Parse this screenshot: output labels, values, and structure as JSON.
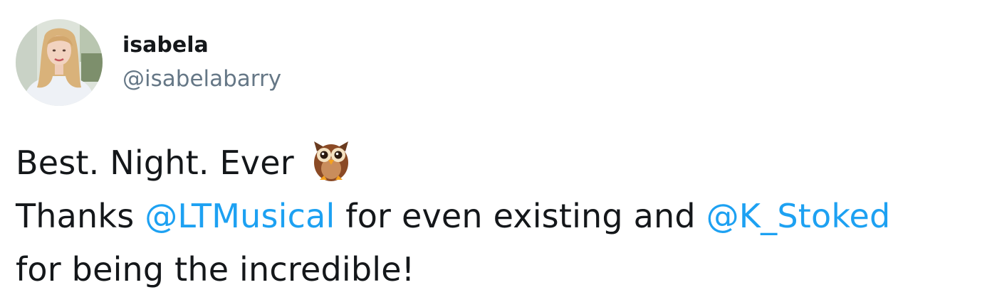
{
  "user": {
    "display_name": "isabela",
    "handle": "@isabelabarry"
  },
  "tweet": {
    "line1": {
      "text": "Best. Night. Ever",
      "emoji_icon": "owl-emoji-icon"
    },
    "line2": {
      "part1": "Thanks ",
      "mention1": "@LTMusical",
      "part2": " for even existing and ",
      "mention2": "@K_Stoked"
    },
    "line3": {
      "text": "for being the incredible!"
    }
  },
  "colors": {
    "text": "#14171a",
    "handle": "#657786",
    "mention": "#1da1f2"
  }
}
